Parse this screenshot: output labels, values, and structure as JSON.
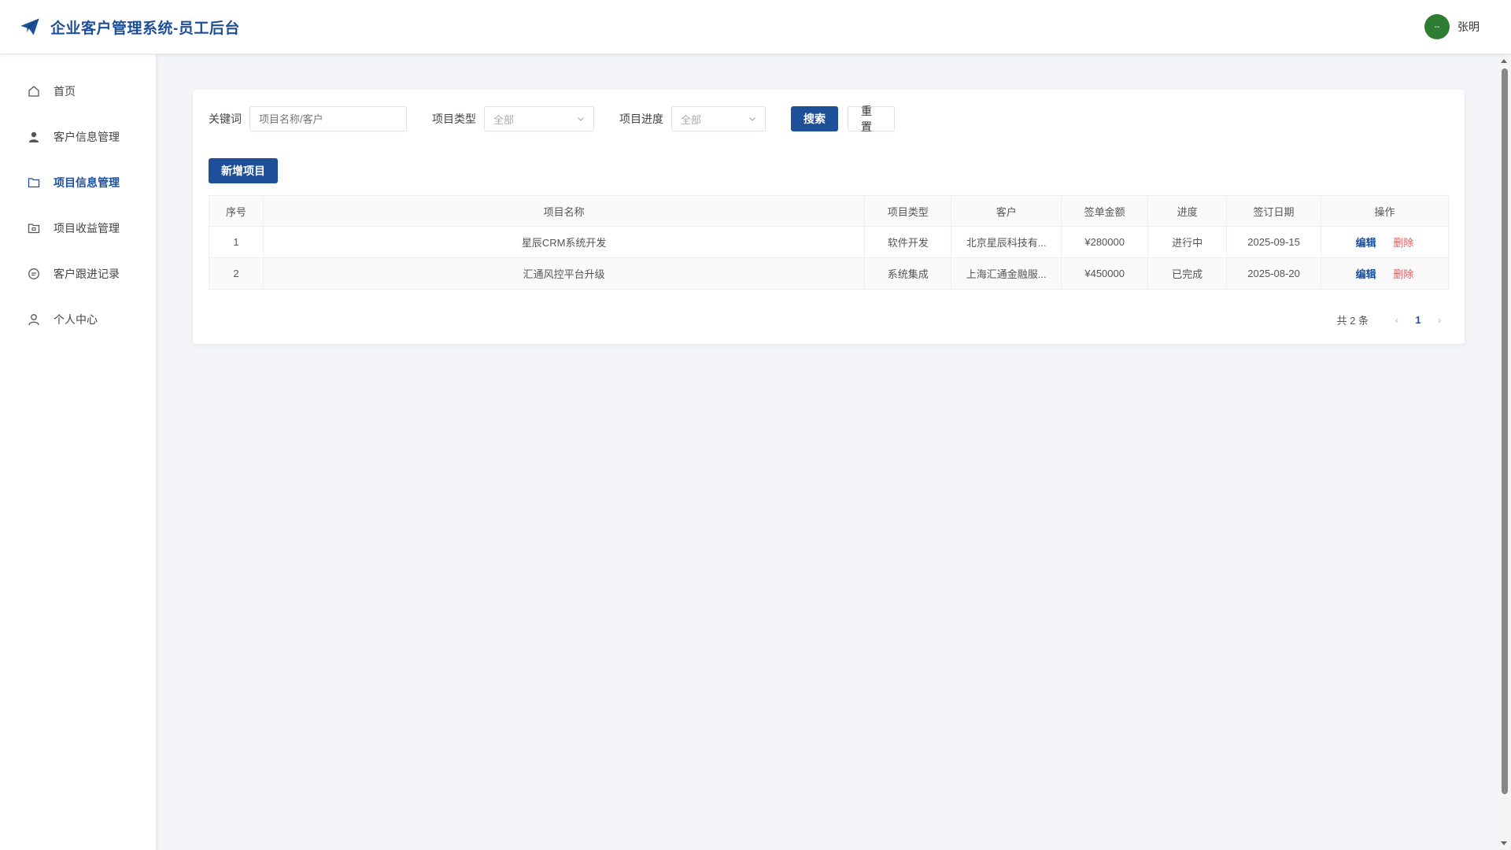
{
  "header": {
    "title": "企业客户管理系统-员工后台",
    "brand_icon": "paper-plane-icon",
    "user": {
      "avatar_text": "--",
      "name": "张明",
      "avatar_color": "#2e7d32"
    }
  },
  "theme": {
    "primary": "#1e4f99",
    "danger": "#e05a5a"
  },
  "sidebar": {
    "items": [
      {
        "label": "首页",
        "icon": "home-icon",
        "active": false
      },
      {
        "label": "客户信息管理",
        "icon": "user-filled-icon",
        "active": false
      },
      {
        "label": "项目信息管理",
        "icon": "folder-icon",
        "active": true
      },
      {
        "label": "项目收益管理",
        "icon": "folder-opened-icon",
        "active": false
      },
      {
        "label": "客户跟进记录",
        "icon": "chat-icon",
        "active": false
      },
      {
        "label": "个人中心",
        "icon": "user-icon",
        "active": false
      }
    ]
  },
  "filters": {
    "keyword_label": "关键词",
    "keyword_placeholder": "项目名称/客户",
    "type_label": "项目类型",
    "type_value": "全部",
    "progress_label": "项目进度",
    "progress_value": "全部",
    "search_label": "搜索",
    "reset_label": "重置"
  },
  "add_button_label": "新增项目",
  "table": {
    "columns": [
      "序号",
      "项目名称",
      "项目类型",
      "客户",
      "签单金额",
      "进度",
      "签订日期",
      "操作"
    ],
    "rows": [
      {
        "index": "1",
        "name": "星辰CRM系统开发",
        "type": "软件开发",
        "client": "北京星辰科技有...",
        "amount": "¥280000",
        "progress": "进行中",
        "date": "2025-09-15",
        "edit": "编辑",
        "delete": "删除"
      },
      {
        "index": "2",
        "name": "汇通风控平台升级",
        "type": "系统集成",
        "client": "上海汇通金融服...",
        "amount": "¥450000",
        "progress": "已完成",
        "date": "2025-08-20",
        "edit": "编辑",
        "delete": "删除"
      }
    ]
  },
  "pagination": {
    "total_text": "共 2 条",
    "current_page": "1",
    "prev": "‹",
    "next": "›"
  }
}
